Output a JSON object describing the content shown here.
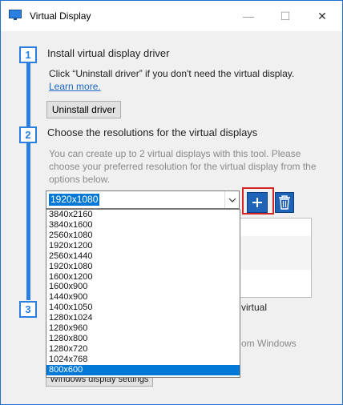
{
  "window": {
    "title": "Virtual Display",
    "minimize": "—",
    "maximize": "☐",
    "close": "✕"
  },
  "step1": {
    "number": "1",
    "heading": "Install virtual display driver",
    "text": "Click “Uninstall driver” if you don't need the virtual display.",
    "link": "Learn more.",
    "button": "Uninstall driver"
  },
  "step2": {
    "number": "2",
    "heading": "Choose the resolutions for the virtual displays",
    "description": "You can create up to 2 virtual displays with this tool.  Please choose your preferred resolution for the virtual display from the options below.",
    "selected_resolution": "1920x1080",
    "resolutions": [
      "3840x2160",
      "3840x1600",
      "2560x1080",
      "1920x1200",
      "2560x1440",
      "1920x1080",
      "1600x1200",
      "1600x900",
      "1440x900",
      "1400x1050",
      "1280x1024",
      "1280x960",
      "1280x800",
      "1280x720",
      "1024x768",
      "800x600"
    ],
    "highlighted_option": "800x600"
  },
  "step3": {
    "number": "3",
    "partial_text": "virtual",
    "partial_text2": "om Windows",
    "button": "Windows display settings"
  },
  "colors": {
    "accent": "#2b7fe0",
    "add_frame": "#d62424",
    "selection": "#0078d7"
  }
}
